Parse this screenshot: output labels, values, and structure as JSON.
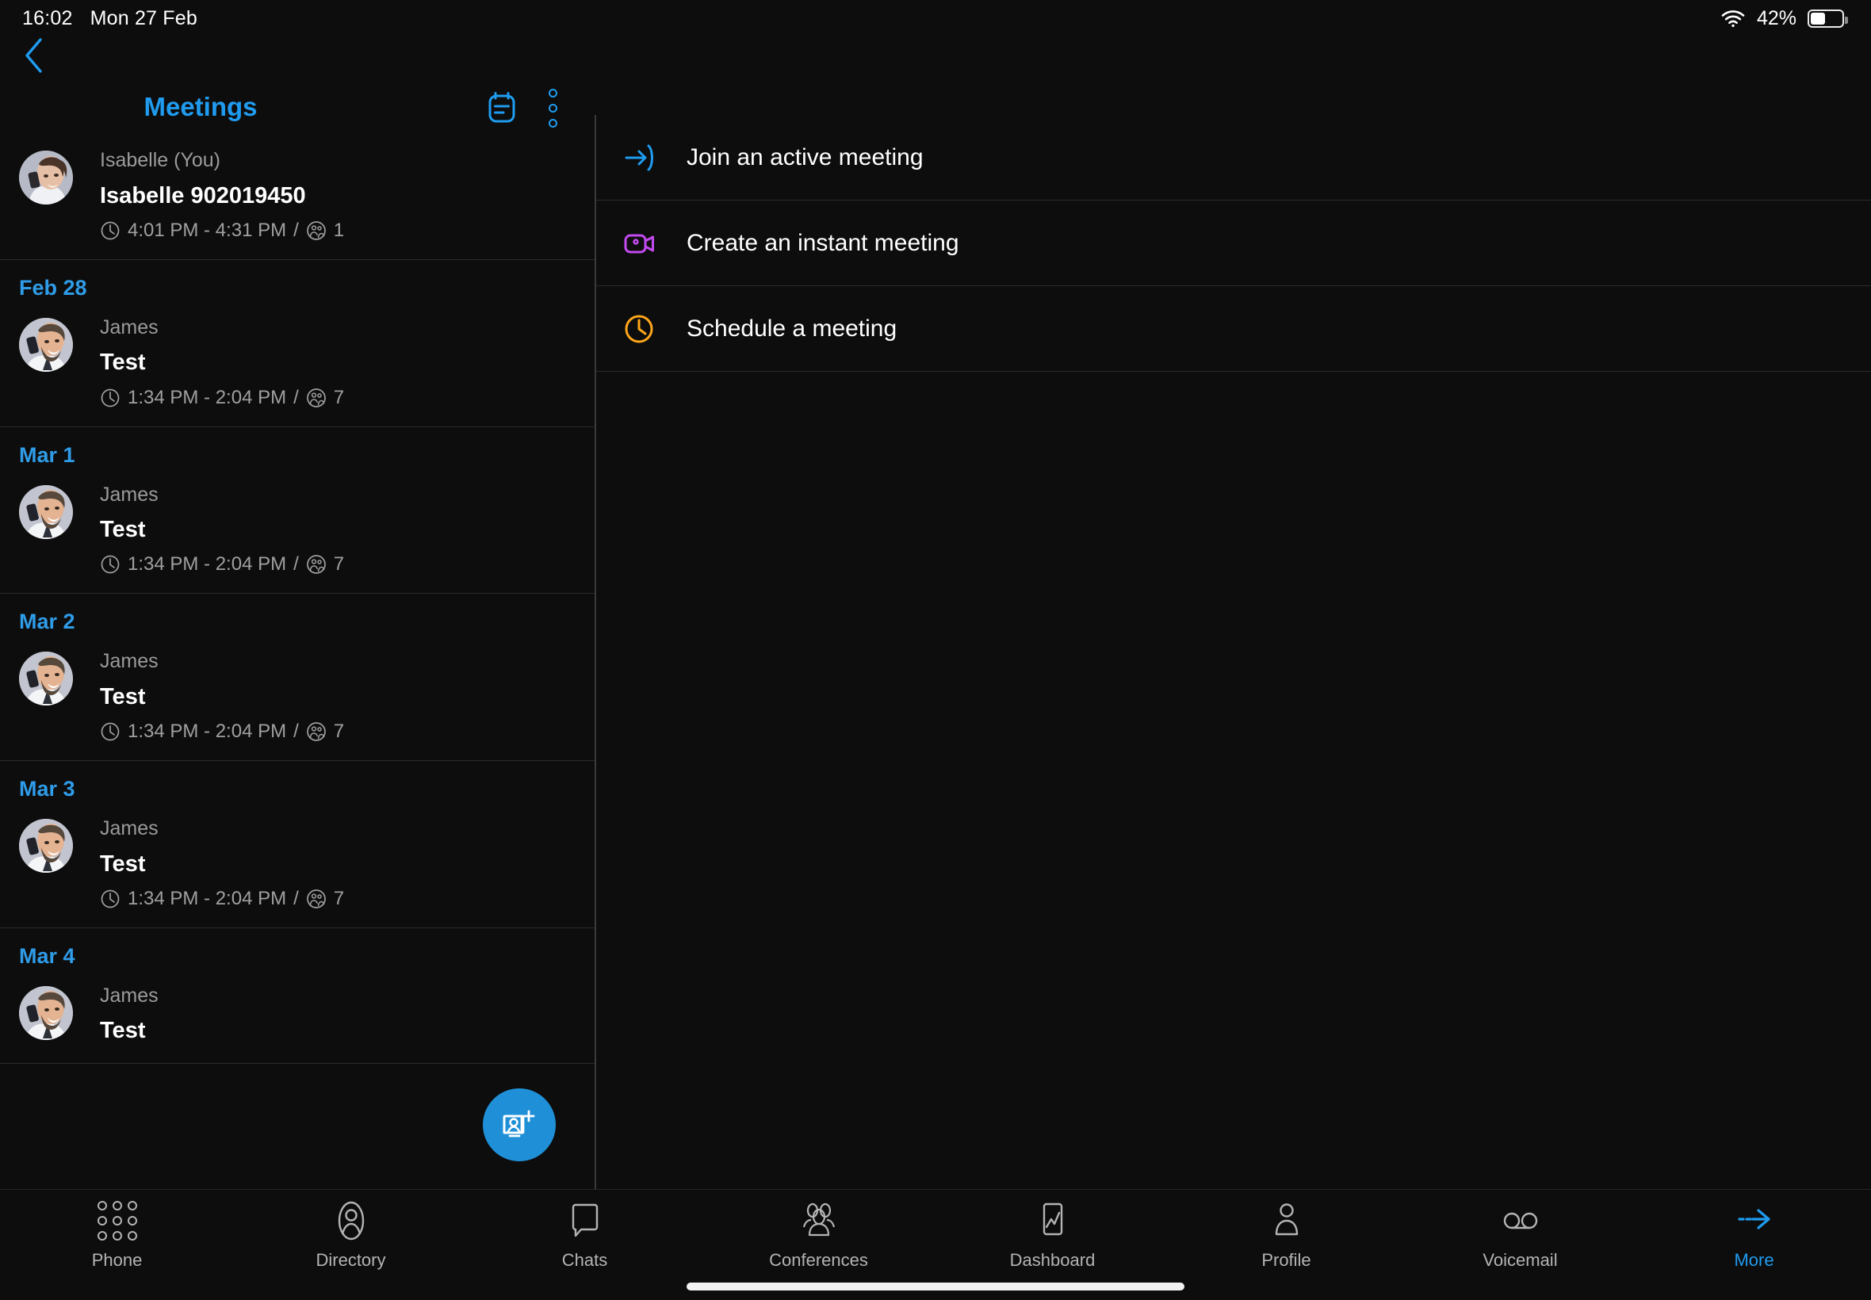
{
  "statusbar": {
    "time": "16:02",
    "date": "Mon 27 Feb",
    "battery_percent": "42%",
    "wifi_icon": "wifi-icon",
    "battery_icon": "battery-icon"
  },
  "nav": {
    "back_icon": "back-chevron-icon"
  },
  "sidebar": {
    "title": "Meetings",
    "notes_icon": "calendar-notes-icon",
    "menu_icon": "kebab-menu-icon",
    "fab_icon": "add-meeting-icon",
    "meetings": [
      {
        "date": "",
        "organizer": "Isabelle (You)",
        "title": "Isabelle 902019450",
        "time": "4:01 PM - 4:31 PM",
        "separator": "/",
        "participants": "1",
        "avatar": "isabelle-avatar"
      },
      {
        "date": "Feb 28",
        "organizer": "James",
        "title": "Test",
        "time": "1:34 PM - 2:04 PM",
        "separator": "/",
        "participants": "7",
        "avatar": "james-avatar"
      },
      {
        "date": "Mar 1",
        "organizer": "James",
        "title": "Test",
        "time": "1:34 PM - 2:04 PM",
        "separator": "/",
        "participants": "7",
        "avatar": "james-avatar"
      },
      {
        "date": "Mar 2",
        "organizer": "James",
        "title": "Test",
        "time": "1:34 PM - 2:04 PM",
        "separator": "/",
        "participants": "7",
        "avatar": "james-avatar"
      },
      {
        "date": "Mar 3",
        "organizer": "James",
        "title": "Test",
        "time": "1:34 PM - 2:04 PM",
        "separator": "/",
        "participants": "7",
        "avatar": "james-avatar"
      },
      {
        "date": "Mar 4",
        "organizer": "James",
        "title": "Test",
        "time": "",
        "separator": "",
        "participants": "",
        "avatar": "james-avatar"
      }
    ]
  },
  "main": {
    "actions": [
      {
        "label": "Join an active meeting",
        "icon": "arrow-into-bracket-icon",
        "color": "#1f9cf0"
      },
      {
        "label": "Create an instant meeting",
        "icon": "video-camera-icon",
        "color": "#c24af0"
      },
      {
        "label": "Schedule a meeting",
        "icon": "clock-icon",
        "color": "#ffa61a"
      }
    ]
  },
  "tabbar": {
    "tabs": [
      {
        "label": "Phone",
        "icon": "dialpad-icon",
        "active": false
      },
      {
        "label": "Directory",
        "icon": "contact-person-icon",
        "active": false
      },
      {
        "label": "Chats",
        "icon": "speech-bubble-icon",
        "active": false
      },
      {
        "label": "Conferences",
        "icon": "people-group-icon",
        "active": false
      },
      {
        "label": "Dashboard",
        "icon": "chart-phone-icon",
        "active": false
      },
      {
        "label": "Profile",
        "icon": "person-icon",
        "active": false
      },
      {
        "label": "Voicemail",
        "icon": "voicemail-icon",
        "active": false
      },
      {
        "label": "More",
        "icon": "dashed-arrow-icon",
        "active": true
      }
    ]
  },
  "colors": {
    "accent_blue": "#1f9cf0",
    "date_blue": "#2f9ce8",
    "purple": "#c24af0",
    "orange": "#ffa61a",
    "background": "#0d0d0d"
  }
}
